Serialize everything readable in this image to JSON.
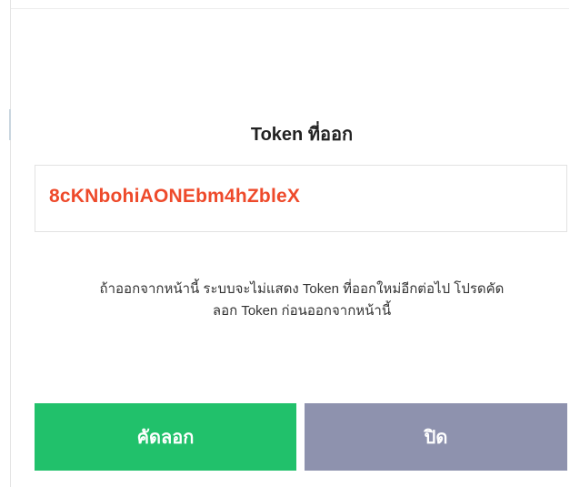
{
  "dialog": {
    "title": "Token ที่ออก",
    "token": "8cKNbohiAONEbm4hZbleX",
    "warning_line1": "ถ้าออกจากหน้านี้ ระบบจะไม่แสดง Token ที่ออกใหม่อีกต่อไป โปรดคัด",
    "warning_line2": "ลอก Token ก่อนออกจากหน้านี้",
    "copy_label": "คัดลอก",
    "close_label": "ปิด"
  },
  "colors": {
    "token": "#ee4a2b",
    "copy_button": "#21c16b",
    "close_button": "#8e92ae"
  }
}
